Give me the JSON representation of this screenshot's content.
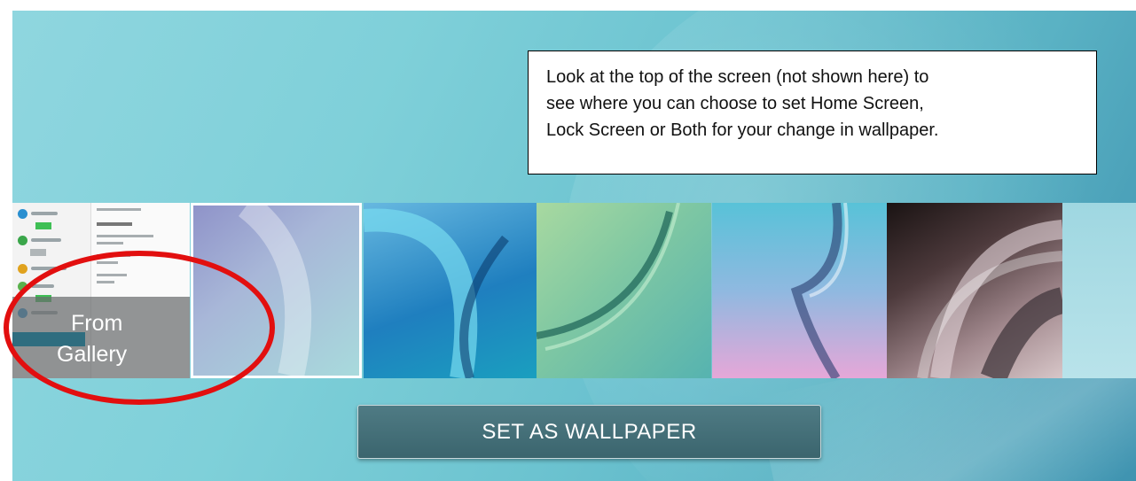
{
  "callout": {
    "lines": [
      "Look at the top of the screen (not shown here) to",
      "see where you can choose to set Home Screen,",
      "Lock Screen or Both for your change in wallpaper."
    ]
  },
  "gallery": {
    "label_line1": "From",
    "label_line2": "Gallery"
  },
  "wallpapers": [
    "wallpaper-1",
    "wallpaper-2",
    "wallpaper-3",
    "wallpaper-4",
    "wallpaper-5",
    "wallpaper-6"
  ],
  "selected_index": 0,
  "button": {
    "label": "SET AS WALLPAPER"
  },
  "colors": {
    "highlight_ring": "#e20f0f",
    "button_bg": "#46707a"
  }
}
